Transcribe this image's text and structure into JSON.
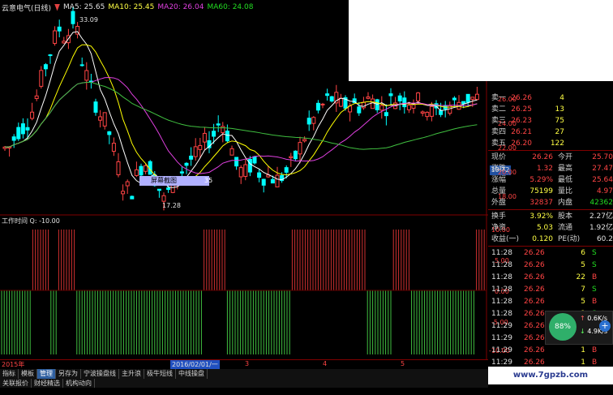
{
  "legend": {
    "name": "云意电气(日线)",
    "ma5": "MA5: 25.65",
    "ma10": "MA10: 25.45",
    "ma20": "MA20: 26.04",
    "ma60": "MA60: 24.08"
  },
  "price_annotations": {
    "high": "33.09",
    "low": "17.28",
    "current_marker": "19.72",
    "tooltip_label": "屏幕截图",
    "tooltip_value": "35"
  },
  "price_axis": [
    "26.00",
    "24.00",
    "22.00",
    "20.00",
    "18.00"
  ],
  "indicator": {
    "title": "工作时间  Q: -10.00",
    "axis": [
      "10.00",
      "5.00",
      "0.00",
      "-5.00",
      "-10.00"
    ]
  },
  "date_axis": {
    "year": "2015年",
    "cursor_date": "2016/02/01/一",
    "month_marks": [
      "3",
      "4",
      "5"
    ]
  },
  "order_book": {
    "sell": [
      {
        "label": "卖一",
        "price": "26.26",
        "vol": "4"
      },
      {
        "label": "卖二",
        "price": "26.25",
        "vol": "13"
      },
      {
        "label": "卖三",
        "price": "26.23",
        "vol": "75"
      },
      {
        "label": "卖四",
        "price": "26.21",
        "vol": "27"
      },
      {
        "label": "卖五",
        "price": "26.20",
        "vol": "122"
      }
    ]
  },
  "quote": [
    {
      "l1": "现价",
      "v1": "26.26",
      "l2": "今开",
      "v2": "25.70"
    },
    {
      "l1": "涨跌",
      "v1": "1.32",
      "l2": "最高",
      "v2": "27.47"
    },
    {
      "l1": "涨幅",
      "v1": "5.29%",
      "l2": "最低",
      "v2": "25.64"
    },
    {
      "l1": "总量",
      "v1": "75199",
      "l2": "量比",
      "v2": "4.97"
    },
    {
      "l1": "外盘",
      "v1": "32837",
      "l2": "内盘",
      "v2": "42362"
    }
  ],
  "fundamentals": [
    {
      "l1": "换手",
      "v1": "3.92%",
      "l2": "股本",
      "v2": "2.27亿"
    },
    {
      "l1": "净资",
      "v1": "5.03",
      "l2": "流通",
      "v2": "1.92亿"
    },
    {
      "l1": "收益(一)",
      "v1": "0.120",
      "l2": "PE(动)",
      "v2": "60.2"
    }
  ],
  "trades": [
    {
      "t": "11:28",
      "p": "26.26",
      "v": "6",
      "d": "S"
    },
    {
      "t": "11:28",
      "p": "26.26",
      "v": "5",
      "d": "S"
    },
    {
      "t": "11:28",
      "p": "26.26",
      "v": "22",
      "d": "B"
    },
    {
      "t": "11:28",
      "p": "26.26",
      "v": "7",
      "d": "S"
    },
    {
      "t": "11:28",
      "p": "26.26",
      "v": "5",
      "d": "B"
    },
    {
      "t": "11:28",
      "p": "26.26",
      "v": "1",
      "d": "S"
    },
    {
      "t": "11:29",
      "p": "26.26",
      "v": "",
      "d": ""
    },
    {
      "t": "11:29",
      "p": "26.26",
      "v": "",
      "d": ""
    },
    {
      "t": "11:29",
      "p": "26.26",
      "v": "1",
      "d": "B"
    },
    {
      "t": "11:29",
      "p": "26.26",
      "v": "1",
      "d": "B"
    }
  ],
  "float_widget": {
    "pct": "88%",
    "up": "0.6K/s",
    "down": "4.9K/s"
  },
  "tabs_row1": [
    "指标",
    "模板",
    "管理",
    "另存为",
    "宁波操盘线",
    "主升浪",
    "极牛短线",
    "中线操盘"
  ],
  "tabs_row1_active": "管理",
  "tabs_row2": [
    "关联报价",
    "财经精选",
    "机构动向"
  ],
  "watermark": "www.7gpzb.com",
  "colors": {
    "up": "#ff4444",
    "down": "#00ffff",
    "ma5": "#ffffff",
    "ma10": "#ffff00",
    "ma20": "#e040e0",
    "ma60": "#40c040"
  }
}
